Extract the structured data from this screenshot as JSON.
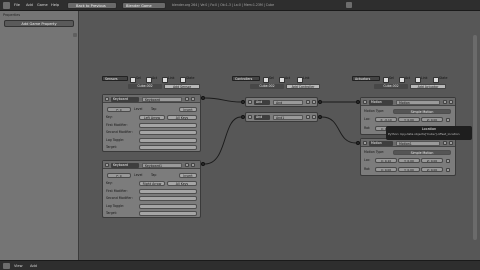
{
  "topbar": {
    "menus": [
      "File",
      "Add",
      "Game",
      "Help"
    ],
    "back_label": "Back to Previous",
    "engine_label": "Blender Game",
    "stats": "blender.org 264 | Ve:0 | Fa:0 | Ob:1-3 | La:0 | Mem:1.23M | Cube"
  },
  "left_panel": {
    "title": "Properties",
    "add_property_label": "Add Game Property"
  },
  "sensors": {
    "header_label": "Sensors",
    "flags": [
      "Sel",
      "Act",
      "Link",
      "State"
    ],
    "object_label": "Cube.002",
    "add_label": "Add Sensor",
    "bricks": [
      {
        "type_label": "Keyboard",
        "name_value": "Keyboard",
        "freq_value": "F: 0",
        "level_label": "Level",
        "tap_label": "Tap",
        "invert_label": "Invert",
        "key_label": "Key:",
        "key_value": "Left Arrow",
        "all_keys_label": "All Keys",
        "first_mod_label": "First Modifier:",
        "second_mod_label": "Second Modifier:",
        "log_toggle_label": "Log Toggle:",
        "target_label": "Target:"
      },
      {
        "type_label": "Keyboard",
        "name_value": "Keyboard1",
        "freq_value": "F: 0",
        "level_label": "Level",
        "tap_label": "Tap",
        "invert_label": "Invert",
        "key_label": "Key:",
        "key_value": "Right Arrow",
        "all_keys_label": "All Keys",
        "first_mod_label": "First Modifier:",
        "second_mod_label": "Second Modifier:",
        "log_toggle_label": "Log Toggle:",
        "target_label": "Target:"
      }
    ]
  },
  "controllers": {
    "header_label": "Controllers",
    "flags": [
      "Sel",
      "Act",
      "Link"
    ],
    "object_label": "Cube.002",
    "add_label": "Add Controller",
    "bricks": [
      {
        "type_label": "And",
        "name_value": "And"
      },
      {
        "type_label": "And",
        "name_value": "And1"
      }
    ]
  },
  "actuators": {
    "header_label": "Actuators",
    "flags": [
      "Sel",
      "Act",
      "Link",
      "State"
    ],
    "object_label": "Cube.002",
    "add_label": "Add Actuator",
    "bricks": [
      {
        "type_label": "Motion",
        "name_value": "Motion",
        "motion_type_label": "Motion Type:",
        "motion_type_value": "Simple Motion",
        "loc_label": "Loc:",
        "loc_values": [
          "X: -0.10",
          "Y: 0.00",
          "Z: 0.00"
        ],
        "rot_label": "Rot:",
        "rot_values": [
          "X: 0.00",
          "Y: 0.00",
          "Z: 0.00"
        ]
      },
      {
        "type_label": "Motion",
        "name_value": "Motion1",
        "motion_type_label": "Motion Type:",
        "motion_type_value": "Simple Motion",
        "loc_label": "Loc:",
        "loc_values": [
          "X: 0.10",
          "Y: 0.00",
          "Z: 0.00"
        ],
        "rot_label": "Rot:",
        "rot_values": [
          "X: 0.00",
          "Y: 0.00",
          "Z: 0.00"
        ]
      }
    ]
  },
  "tooltip": {
    "title": "Location",
    "body": "Python: bpy.data.objects['Cube'].offset_location"
  },
  "bottombar": {
    "menus": [
      "View",
      "Add"
    ]
  },
  "colors": {
    "editor_bg": "#575757",
    "brick_bg": "#7c7c7c",
    "link_color": "#1a1a1a"
  }
}
